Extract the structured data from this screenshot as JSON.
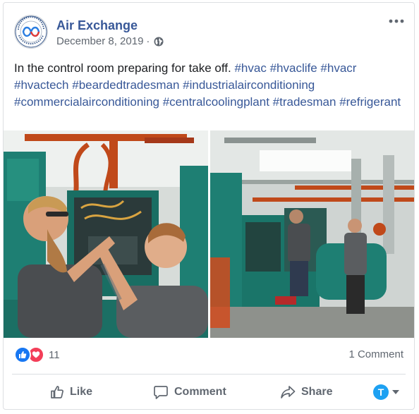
{
  "post": {
    "page_name": "Air Exchange",
    "date": "December 8, 2019",
    "separator": "·",
    "privacy_icon": "globe-icon",
    "message_text": "In the control room preparing for take off. ",
    "hashtags": [
      "#hvac",
      "#hvaclife",
      "#hvacr",
      "#hvactech",
      "#beardedtradesman",
      "#industrialairconditioning",
      "#commercialairconditioning",
      "#centralcoolingplant",
      "#tradesman",
      "#refrigerant"
    ]
  },
  "reactions": {
    "icons": [
      "like-reaction-icon",
      "love-reaction-icon"
    ],
    "count": "11"
  },
  "comments": {
    "count_label": "1 Comment"
  },
  "actions": {
    "like": "Like",
    "comment": "Comment",
    "share": "Share",
    "account_initial": "T"
  },
  "colors": {
    "link": "#385898",
    "accent": "#1877f2",
    "love": "#f33e58",
    "equipment_teal": "#1e7f73",
    "pipe_orange": "#c0491a"
  }
}
